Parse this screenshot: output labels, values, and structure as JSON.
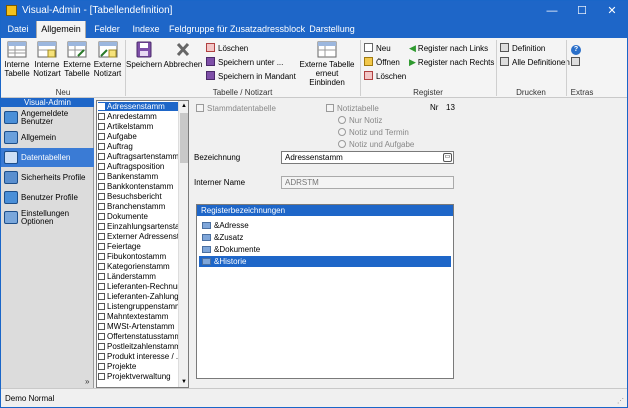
{
  "window": {
    "title": "Visual-Admin - [Tabellendefinition]",
    "minimize": "—",
    "maximize": "☐",
    "close": "✕"
  },
  "menu": [
    "Datei",
    "Allgemein",
    "Felder",
    "Indexe",
    "Feldgruppe für Zusatzadressblock",
    "Darstellung"
  ],
  "ribbon": {
    "neu": {
      "labels": [
        "Interne Tabelle",
        "Interne Notizart",
        "Externe Tabelle",
        "Externe Notizart"
      ],
      "group": "Neu"
    },
    "tabelle": {
      "speichern": "Speichern",
      "abbrechen": "Abbrechen",
      "loeschen": "Löschen",
      "speichern_unter": "Speichern unter ...",
      "speichern_mandant": "Speichern in Mandant",
      "extern_einbinden": "Externe Tabelle erneut Einbinden",
      "group": "Tabelle / Notizart"
    },
    "register": {
      "neu": "Neu",
      "oeffnen": "Öffnen",
      "loeschen": "Löschen",
      "nach_links": "Register nach Links",
      "nach_rechts": "Register nach Rechts",
      "group": "Register"
    },
    "drucken": {
      "definition": "Definition",
      "alle": "Alle Definitionen",
      "group": "Drucken"
    },
    "extras": {
      "group": "Extras"
    }
  },
  "nav": {
    "header": "Visual-Admin",
    "items": [
      "Angemeldete Benutzer",
      "Allgemein",
      "Datentabellen",
      "Sicherheits Profile",
      "Benutzer Profile",
      "Einstellungen Optionen"
    ],
    "selected": 2,
    "more": "»"
  },
  "tables": [
    "Adressenstamm",
    "Anredestamm",
    "Artikelstamm",
    "Aufgabe",
    "Auftrag",
    "Auftragsartenstamm",
    "Auftragsposition",
    "Bankenstamm",
    "Bankkontenstamm",
    "Besuchsbericht",
    "Branchenstamm",
    "Dokumente",
    "Einzahlungsartenstamm",
    "Externer Adressenstamm",
    "Feiertage",
    "Fibukontostamm",
    "Kategorienstamm",
    "Länderstamm",
    "Lieferanten-Rechnung",
    "Lieferanten-Zahlung",
    "Listengruppenstamm",
    "Mahntextestamm",
    "MWSt-Artenstamm",
    "Offertenstatusstamm",
    "Postleitzahlenstamm",
    "Produkt interesse / ...",
    "Projekte",
    "Projektverwaltung"
  ],
  "detail": {
    "stammdaten": "Stammdatentabelle",
    "notiztabelle": "Notiztabelle",
    "nr_label": "Nr",
    "nr_value": "13",
    "radios": [
      "Nur Notiz",
      "Notiz und Termin",
      "Notiz und Aufgabe"
    ],
    "bezeichnung_label": "Bezeichnung",
    "bezeichnung_value": "Adressenstamm",
    "internal_label": "Interner Name",
    "internal_value": "ADRSTM",
    "register_header": "Registerbezeichnungen",
    "register_items": [
      "&Adresse",
      "&Zusatz",
      "&Dokumente",
      "&Historie"
    ],
    "register_selected": 3
  },
  "status": {
    "text": "Demo Normal"
  },
  "colors": {
    "titlebar": "#1e66c8",
    "selection": "#1e66c8",
    "nav_selected": "#3a7bd5"
  }
}
